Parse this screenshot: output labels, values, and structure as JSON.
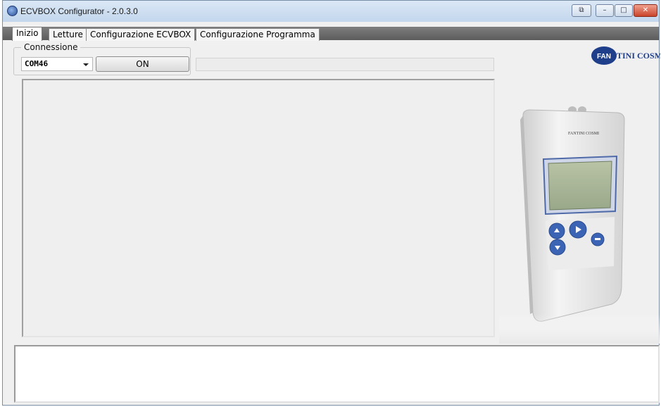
{
  "window": {
    "title": "ECVBOX Configurator - 2.0.3.0"
  },
  "titlebar": {
    "buttons": [
      {
        "name": "restore",
        "glyph": "⧉"
      },
      {
        "name": "minimize",
        "glyph": "–"
      },
      {
        "name": "maximize",
        "glyph": "□"
      },
      {
        "name": "close",
        "glyph": "✕"
      }
    ]
  },
  "tabs": [
    {
      "label": "Inizio",
      "active": true
    },
    {
      "label": "Letture",
      "active": false
    },
    {
      "label": "Configurazione ECVBOX",
      "active": false
    },
    {
      "label": "Configurazione Programma",
      "active": false
    }
  ],
  "connection": {
    "group_label": "Connessione",
    "port_value": "COM46",
    "on_button": "ON",
    "status_text": ""
  },
  "brand": {
    "logo_text": "FANTINI COSMI",
    "device_label": "FANTINI COSMI",
    "color": "#1f3f8a"
  },
  "icons": {
    "app": "app-logo-icon",
    "dropdown": "chevron-down-icon"
  }
}
